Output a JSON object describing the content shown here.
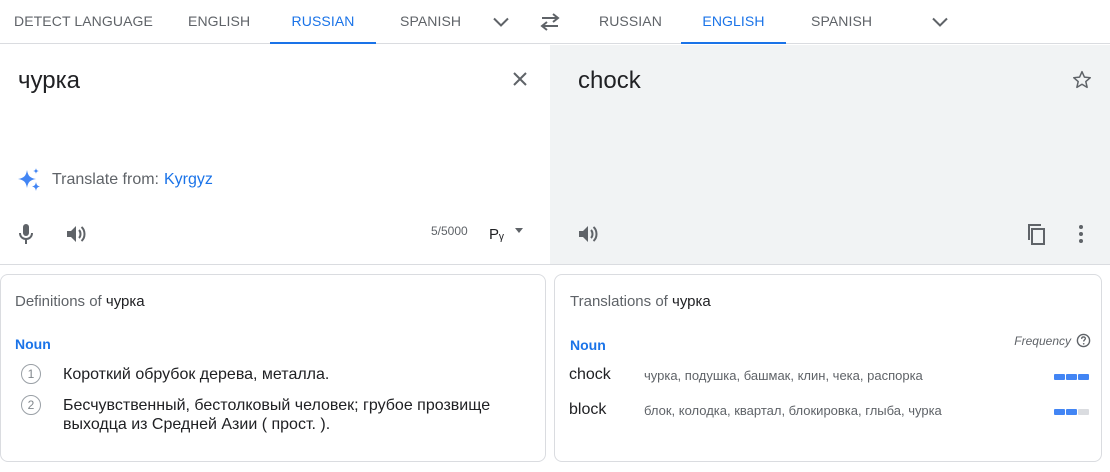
{
  "source_langs": {
    "tabs": [
      "DETECT LANGUAGE",
      "ENGLISH",
      "RUSSIAN",
      "SPANISH"
    ],
    "active": "RUSSIAN"
  },
  "target_langs": {
    "tabs": [
      "RUSSIAN",
      "ENGLISH",
      "SPANISH"
    ],
    "active": "ENGLISH"
  },
  "source": {
    "text": "чурка",
    "suggest_prefix": "Translate from:",
    "suggest_lang": "Kyrgyz",
    "char_count": "5/5000",
    "input_method": "Рᵧ"
  },
  "target": {
    "text": "chock"
  },
  "definitions": {
    "heading_prefix": "Definitions of",
    "word": "чурка",
    "pos": "Noun",
    "items": [
      {
        "num": "1",
        "text": "Короткий обрубок дерева, металла."
      },
      {
        "num": "2",
        "text": "Бесчувственный, бестолковый человек; грубое прозвище выходца из Средней Азии ( прост. )."
      }
    ]
  },
  "translations": {
    "heading_prefix": "Translations of",
    "word": "чурка",
    "pos": "Noun",
    "frequency_label": "Frequency",
    "rows": [
      {
        "word": "chock",
        "synonyms": "чурка, подушка, башмак, клин, чека, распорка",
        "frequency": 3
      },
      {
        "word": "block",
        "synonyms": "блок, колодка, квартал, блокировка, глыба, чурка",
        "frequency": 2
      }
    ]
  },
  "colors": {
    "accent": "#1a73e8",
    "target_bg": "#f1f3f4",
    "freq_on": "#4285f4",
    "freq_off": "#dadce0"
  }
}
